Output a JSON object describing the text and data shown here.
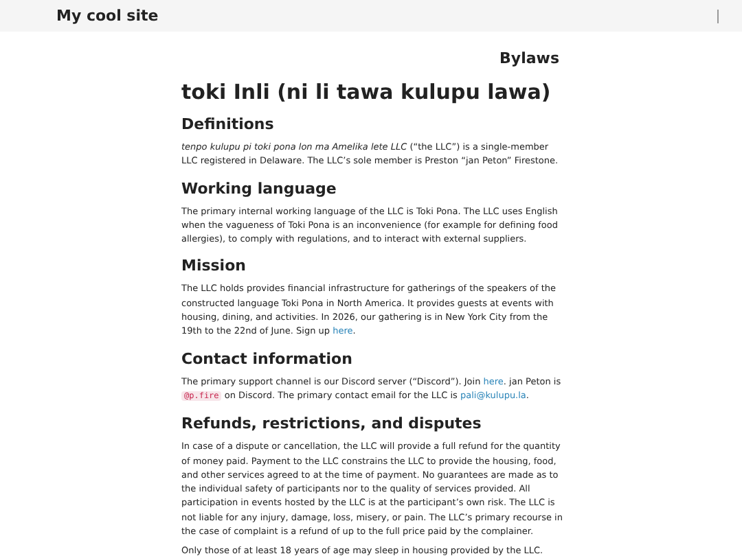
{
  "site": {
    "title": "My cool site"
  },
  "page": {
    "crumb": "Bylaws",
    "title": "toki Inli (ni li tawa kulupu lawa)"
  },
  "sections": [
    {
      "heading": "Definitions",
      "paragraphs": [
        [
          {
            "kind": "italic",
            "text": "tenpo kulupu pi toki pona lon ma Amelika lete LLC"
          },
          {
            "kind": "text",
            "text": " (“the LLC”) is a single-member LLC registered in Delaware. The LLC’s sole member is Preston “jan Peton” Firestone."
          }
        ]
      ]
    },
    {
      "heading": "Working language",
      "paragraphs": [
        [
          {
            "kind": "text",
            "text": "The primary internal working language of the LLC is Toki Pona. The LLC uses English when the vagueness of Toki Pona is an inconvenience (for example for defining food allergies), to comply with regulations, and to interact with external suppliers."
          }
        ]
      ]
    },
    {
      "heading": "Mission",
      "paragraphs": [
        [
          {
            "kind": "text",
            "text": "The LLC holds provides financial infrastructure for gatherings of the speakers of the constructed language Toki Pona in North America. It provides guests at events with housing, dining, and activities. In 2026, our gathering is in New York City from the 19th to the 22nd of June. Sign up "
          },
          {
            "kind": "link",
            "text": "here"
          },
          {
            "kind": "text",
            "text": "."
          }
        ]
      ]
    },
    {
      "heading": "Contact information",
      "paragraphs": [
        [
          {
            "kind": "text",
            "text": "The primary support channel is our Discord server (“Discord”). Join "
          },
          {
            "kind": "link",
            "text": "here"
          },
          {
            "kind": "text",
            "text": ". jan Peton is "
          },
          {
            "kind": "code",
            "text": "@p.fire"
          },
          {
            "kind": "text",
            "text": " on Discord. The primary contact email for the LLC is "
          },
          {
            "kind": "link",
            "text": "pali@kulupu.la"
          },
          {
            "kind": "text",
            "text": "."
          }
        ]
      ]
    },
    {
      "heading": "Refunds, restrictions, and disputes",
      "paragraphs": [
        [
          {
            "kind": "text",
            "text": "In case of a dispute or cancellation, the LLC will provide a full refund for the quantity of money paid. Payment to the LLC constrains the LLC to provide the housing, food, and other services agreed to at the time of payment. No guarantees are made as to the individual safety of participants nor to the quality of services provided. All participation in events hosted by the LLC is at the participant’s own risk. The LLC is not liable for any injury, damage, loss, misery, or pain. The LLC’s primary recourse in the case of complaint is a refund of up to the full price paid by the complainer."
          }
        ],
        [
          {
            "kind": "text",
            "text": "Only those of at least 18 years of age may sleep in housing provided by the LLC."
          }
        ]
      ]
    }
  ]
}
